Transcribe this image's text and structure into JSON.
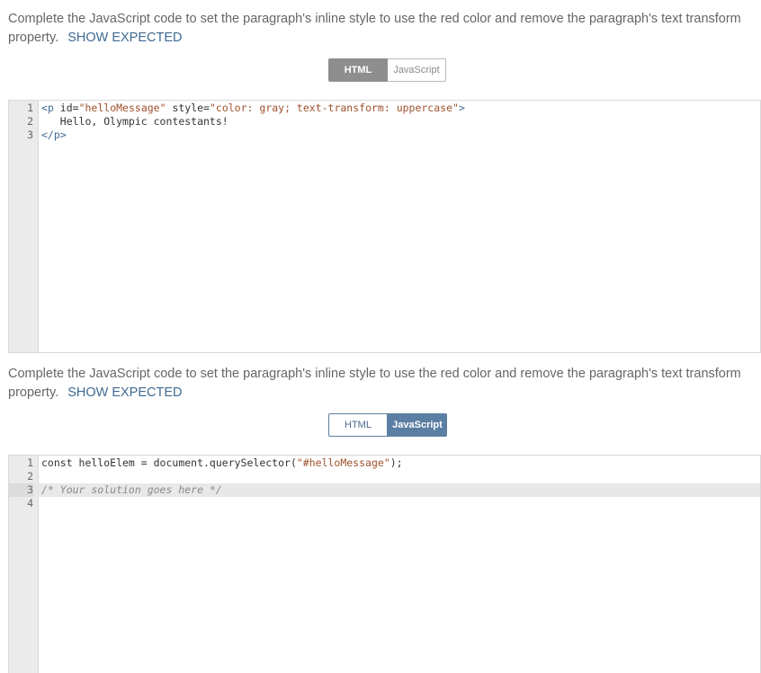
{
  "exercise1": {
    "instruction": "Complete the JavaScript code to set the paragraph's inline style to use the red color and remove the paragraph's text transform property.",
    "show_expected": "SHOW EXPECTED",
    "tabs": {
      "html": "HTML",
      "javascript": "JavaScript",
      "active": "HTML"
    },
    "editor": {
      "lines": [
        {
          "num": "1",
          "parts": [
            {
              "t": "<",
              "c": "tag"
            },
            {
              "t": "p",
              "c": "tag"
            },
            {
              "t": " id=",
              "c": "attr"
            },
            {
              "t": "\"helloMessage\"",
              "c": "str"
            },
            {
              "t": " style=",
              "c": "attr"
            },
            {
              "t": "\"color: gray; text-transform: uppercase\"",
              "c": "str"
            },
            {
              "t": ">",
              "c": "tag"
            }
          ]
        },
        {
          "num": "2",
          "parts": [
            {
              "t": "   Hello, Olympic contestants!",
              "c": "attr"
            }
          ]
        },
        {
          "num": "3",
          "parts": [
            {
              "t": "</",
              "c": "tag"
            },
            {
              "t": "p",
              "c": "tag"
            },
            {
              "t": ">",
              "c": "tag"
            }
          ]
        }
      ]
    }
  },
  "exercise2": {
    "instruction": "Complete the JavaScript code to set the paragraph's inline style to use the red color and remove the paragraph's text transform property.",
    "show_expected": "SHOW EXPECTED",
    "tabs": {
      "html": "HTML",
      "javascript": "JavaScript",
      "active": "JavaScript"
    },
    "editor": {
      "lines": [
        {
          "num": "1",
          "parts": [
            {
              "t": "const helloElem = document.querySelector(",
              "c": "attr"
            },
            {
              "t": "\"#helloMessage\"",
              "c": "str"
            },
            {
              "t": ");",
              "c": "attr"
            }
          ]
        },
        {
          "num": "2",
          "parts": []
        },
        {
          "num": "3",
          "highlight": true,
          "parts": [
            {
              "t": "/* Your solution goes here */",
              "c": "cmt"
            }
          ]
        },
        {
          "num": "4",
          "parts": []
        }
      ]
    }
  }
}
